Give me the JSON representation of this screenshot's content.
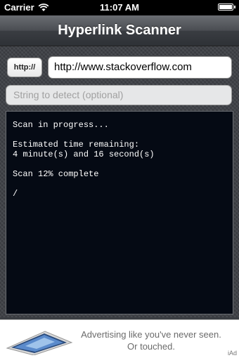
{
  "status_bar": {
    "carrier": "Carrier",
    "time": "11:07 AM",
    "wifi_icon": "wifi-icon",
    "battery_icon": "battery-icon"
  },
  "nav": {
    "title": "Hyperlink Scanner"
  },
  "form": {
    "protocol_label": "http://",
    "url_value": "http://www.stackoverflow.com",
    "detect_placeholder": "String to detect (optional)"
  },
  "console": {
    "lines": [
      "Scan in progress...",
      "",
      "Estimated time remaining:",
      "4 minute(s) and 16 second(s)",
      "",
      "Scan 12% complete",
      "",
      "/"
    ]
  },
  "ad": {
    "line1": "Advertising like you've never seen.",
    "line2": "Or touched.",
    "tag": "iAd",
    "image_icon": "ipad-icon"
  },
  "colors": {
    "console_bg": "#050a14",
    "console_text": "#ffffff",
    "content_bg": "#3d4045"
  }
}
